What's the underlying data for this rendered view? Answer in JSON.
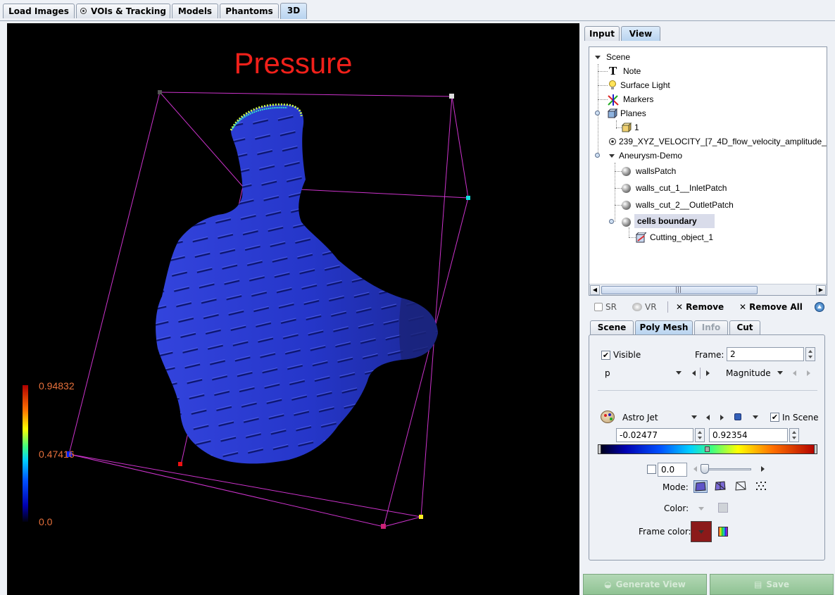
{
  "top_tabs": [
    "Load Images",
    "VOIs & Tracking",
    "Models",
    "Phantoms",
    "3D"
  ],
  "viewer": {
    "title": "Pressure",
    "colorbar": {
      "max": "0.94832",
      "mid": "0.47416",
      "min": "0.0"
    }
  },
  "panel_tabs": [
    "Input",
    "View"
  ],
  "tree": {
    "scene": "Scene",
    "note": "Note",
    "surface_light": "Surface Light",
    "markers": "Markers",
    "planes": "Planes",
    "plane_1": "1",
    "velocity": "239_XYZ_VELOCITY_[7_4D_flow_velocity_amplitude_",
    "aneurysm": "Aneurysm-Demo",
    "walls_patch": "wallsPatch",
    "inlet": "walls_cut_1__InletPatch",
    "outlet": "walls_cut_2__OutletPatch",
    "cells_boundary": "cells boundary",
    "cutting": "Cutting_object_1"
  },
  "toolbar": {
    "sr": "SR",
    "vr": "VR",
    "remove": "Remove",
    "remove_all": "Remove All"
  },
  "sub_tabs": [
    "Scene",
    "Poly Mesh",
    "Info",
    "Cut"
  ],
  "polymesh": {
    "visible_label": "Visible",
    "frame_label": "Frame:",
    "frame_value": "2",
    "variable": "p",
    "component": "Magnitude",
    "colormap": "Astro Jet",
    "in_scene_label": "In Scene",
    "range_min": "-0.02477",
    "range_max": "0.92354",
    "transparency_value": "0.0",
    "mode_label": "Mode:",
    "color_label": "Color:",
    "frame_color_label": "Frame color:",
    "frame_color": "#8b1a1a"
  },
  "bottom_buttons": [
    "Generate View",
    "Save"
  ],
  "colors": {
    "accent_tab": "#b8d3ef",
    "title_red": "#f0201a",
    "bbox_magenta": "#cc33cc",
    "mesh_blue": "#2233cc"
  }
}
